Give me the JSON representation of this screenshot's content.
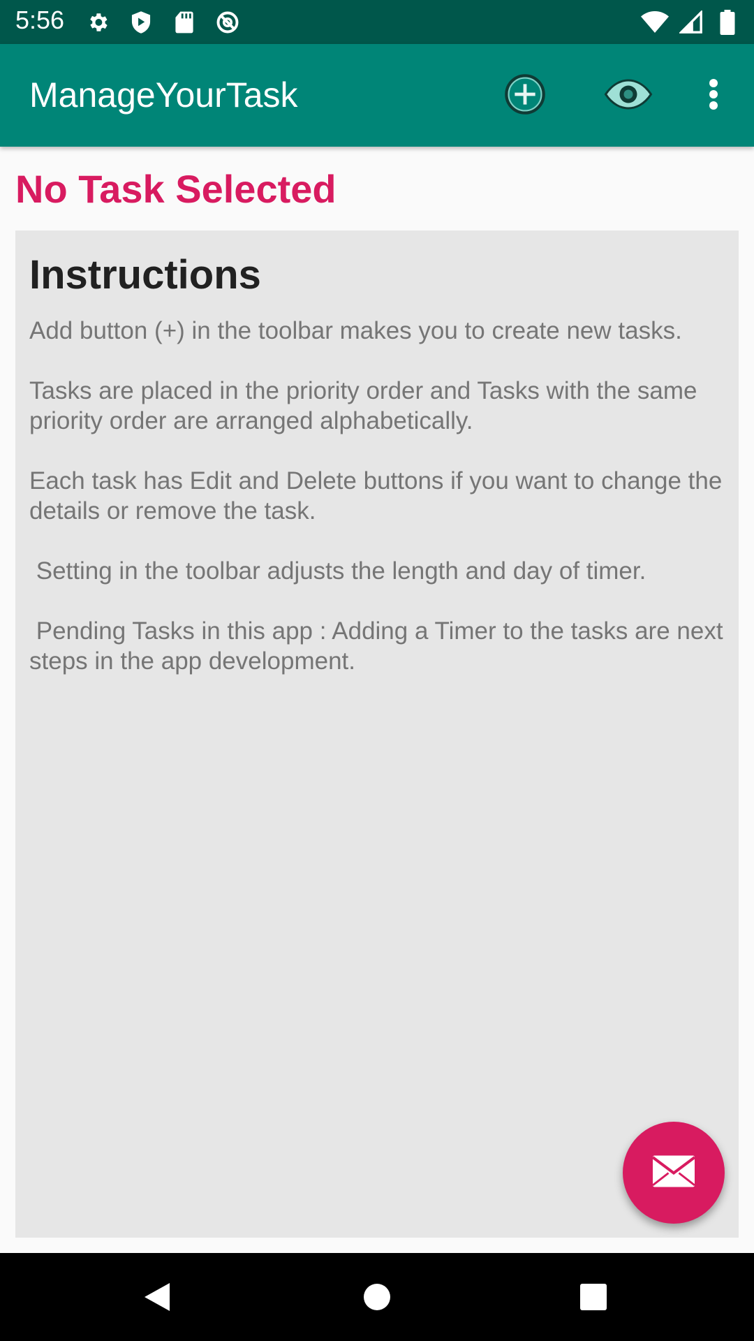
{
  "status_bar": {
    "time": "5:56",
    "icons_left": [
      "gear-icon",
      "play-shield-icon",
      "sd-card-icon",
      "no-sync-icon"
    ],
    "icons_right": [
      "wifi-icon",
      "signal-icon",
      "battery-icon"
    ]
  },
  "app_bar": {
    "title": "ManageYourTask",
    "actions": [
      "add-circle-icon",
      "eye-icon",
      "overflow-menu-icon"
    ]
  },
  "main": {
    "status_text": "No Task Selected",
    "instructions": {
      "title": "Instructions",
      "paragraphs": [
        "Add button (+) in the toolbar makes you to create new tasks.",
        "Tasks are placed in the priority order and Tasks with the same priority order are arranged alphabetically.",
        "Each task has Edit and Delete buttons if you want to change the details or remove the task.",
        " Setting in the toolbar adjusts the length and day of timer.",
        " Pending Tasks in this app : Adding a Timer to the tasks are next steps in the app development."
      ]
    }
  },
  "fab": {
    "icon": "mail-icon"
  },
  "colors": {
    "status_bar": "#00574b",
    "app_bar": "#008577",
    "accent": "#d81b60",
    "card": "#e6e6e6"
  }
}
